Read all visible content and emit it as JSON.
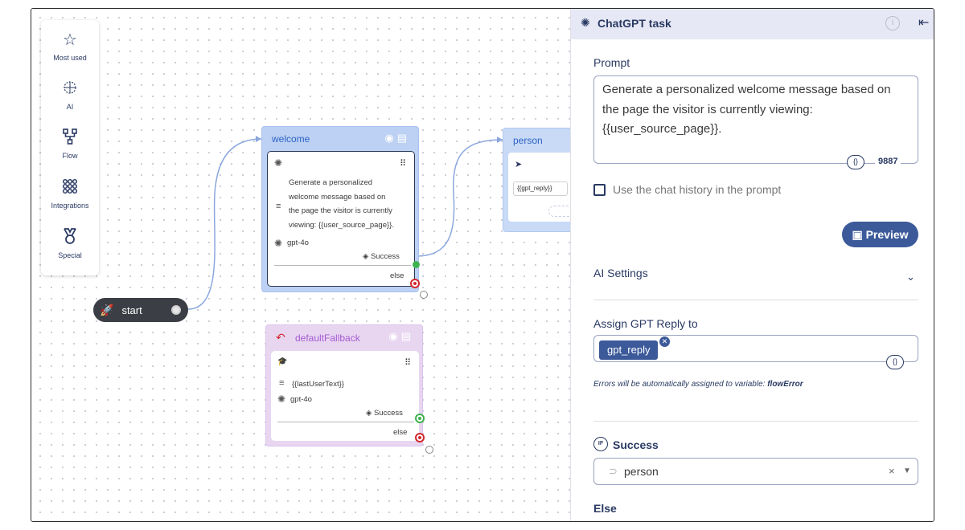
{
  "palette": {
    "items": [
      {
        "label": "Most used",
        "icon": "star-icon"
      },
      {
        "label": "AI",
        "icon": "ai-brain-icon"
      },
      {
        "label": "Flow",
        "icon": "flow-icon"
      },
      {
        "label": "Integrations",
        "icon": "integrations-icon"
      },
      {
        "label": "Special",
        "icon": "special-icon"
      }
    ]
  },
  "canvas": {
    "start": {
      "label": "start"
    },
    "welcome": {
      "title": "welcome",
      "text": "Generate a personalized welcome message based on the page the visitor is currently viewing: {{user_source_page}}.",
      "text_lines": [
        "Generate a personalized",
        "welcome message based on",
        "the page the visitor is currently",
        "viewing: {{user_source_page}}."
      ],
      "model": "gpt-4o",
      "success": "Success",
      "else": "else"
    },
    "person": {
      "title": "person",
      "variable": "{{gpt_reply}}"
    },
    "fallback": {
      "title": "defaultFallback",
      "text": "{{lastUserText}}",
      "model": "gpt-4o",
      "success": "Success",
      "else": "else"
    }
  },
  "panel": {
    "title": "ChatGPT task",
    "prompt_label": "Prompt",
    "prompt_lines": [
      "Generate a personalized welcome message based on",
      "the page the visitor is currently viewing:",
      "{{user_source_page}}."
    ],
    "var_button": "{}",
    "char_count": "9887",
    "chat_history_label": "Use the chat history in the prompt",
    "chat_history_checked": false,
    "preview_label": "Preview",
    "ai_settings_label": "AI Settings",
    "assign_label": "Assign GPT Reply to",
    "assign_chip": "gpt_reply",
    "errors_note_prefix": "Errors will be automatically assigned to variable: ",
    "errors_variable": "flowError",
    "success_label": "Success",
    "success_target": "person",
    "else_label": "Else"
  },
  "colors": {
    "accent": "#3c5a9a",
    "node_blue": "#bcd1f3",
    "node_purple": "#e8d6f1",
    "success_green": "#3fb34f",
    "else_red": "#d3282f"
  }
}
